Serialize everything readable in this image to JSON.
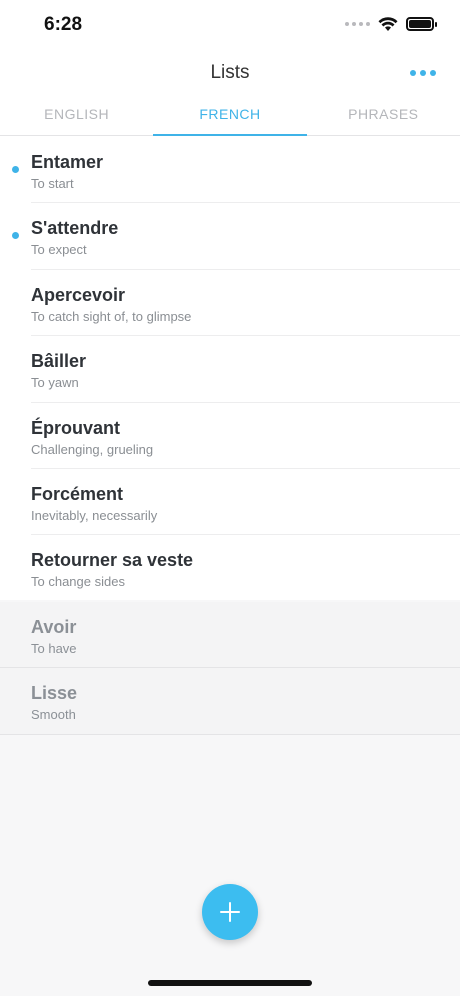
{
  "status_bar": {
    "time": "6:28"
  },
  "nav": {
    "title": "Lists"
  },
  "tabs": [
    {
      "label": "ENGLISH",
      "active": false
    },
    {
      "label": "FRENCH",
      "active": true
    },
    {
      "label": "PHRASES",
      "active": false
    }
  ],
  "items": [
    {
      "word": "Entamer",
      "translation": "To start",
      "new": true,
      "archived": false
    },
    {
      "word": "S'attendre",
      "translation": "To expect",
      "new": true,
      "archived": false
    },
    {
      "word": "Apercevoir",
      "translation": "To catch sight of, to glimpse",
      "new": false,
      "archived": false
    },
    {
      "word": "Bâiller",
      "translation": "To yawn",
      "new": false,
      "archived": false
    },
    {
      "word": "Éprouvant",
      "translation": "Challenging, grueling",
      "new": false,
      "archived": false
    },
    {
      "word": "Forcément",
      "translation": "Inevitably, necessarily",
      "new": false,
      "archived": false
    },
    {
      "word": "Retourner sa veste",
      "translation": "To change sides",
      "new": false,
      "archived": false
    },
    {
      "word": "Avoir",
      "translation": "To have",
      "new": false,
      "archived": true
    },
    {
      "word": "Lisse",
      "translation": "Smooth",
      "new": false,
      "archived": true
    }
  ],
  "colors": {
    "accent": "#3fb3e8",
    "fab": "#3cbdf0"
  },
  "icons": {
    "more": "more-dots-icon",
    "add": "plus-icon"
  }
}
